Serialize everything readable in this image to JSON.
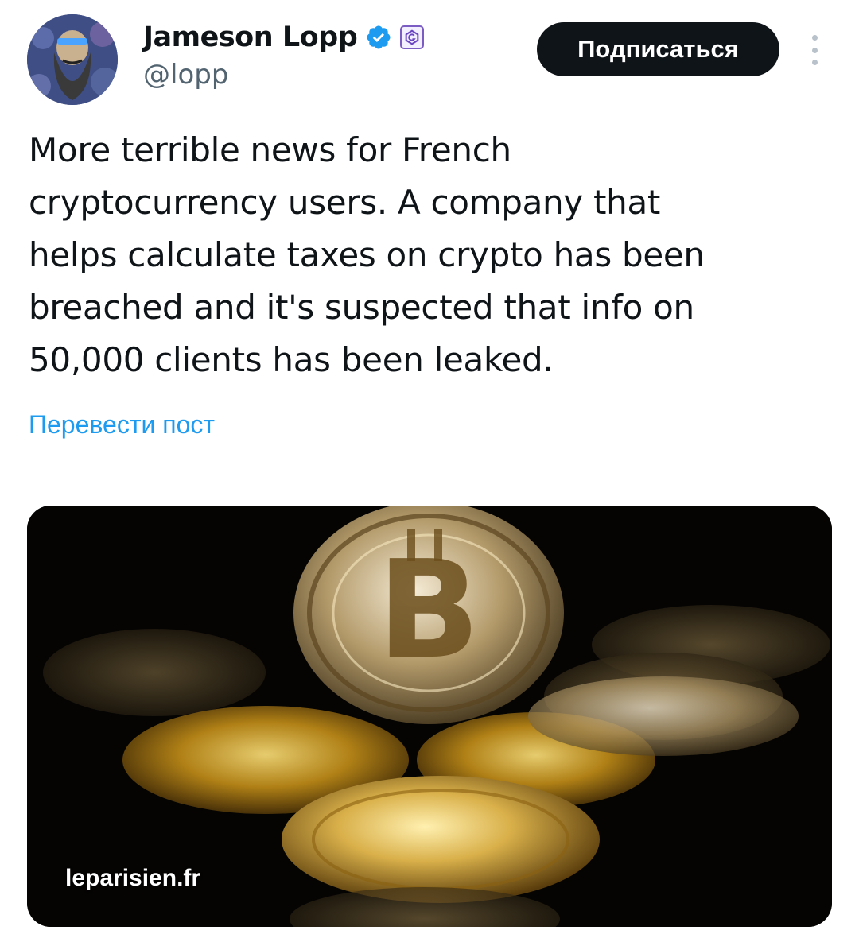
{
  "author": {
    "display_name": "Jameson Lopp",
    "handle": "@lopp",
    "avatar_icon": "bearded-man-avatar",
    "verified_icon": "verified-badge-icon",
    "affiliate_icon": "affiliate-badge-icon"
  },
  "actions": {
    "subscribe_label": "Подписаться",
    "more_icon": "more-vertical-icon"
  },
  "tweet": {
    "lines": [
      "More terrible news for French",
      "cryptocurrency users. A company that",
      "helps calculate taxes on crypto has been",
      "breached and it's suspected that info on",
      "50,000 clients has been leaked."
    ],
    "translate_label": "Перевести пост"
  },
  "media": {
    "description_icon": "bitcoin-coins-photo",
    "link_domain": "leparisien.fr"
  },
  "colors": {
    "text": "#0f1419",
    "secondary": "#536471",
    "link": "#1d9bf0",
    "button_bg": "#0f1419",
    "verified": "#1d9bf0"
  }
}
